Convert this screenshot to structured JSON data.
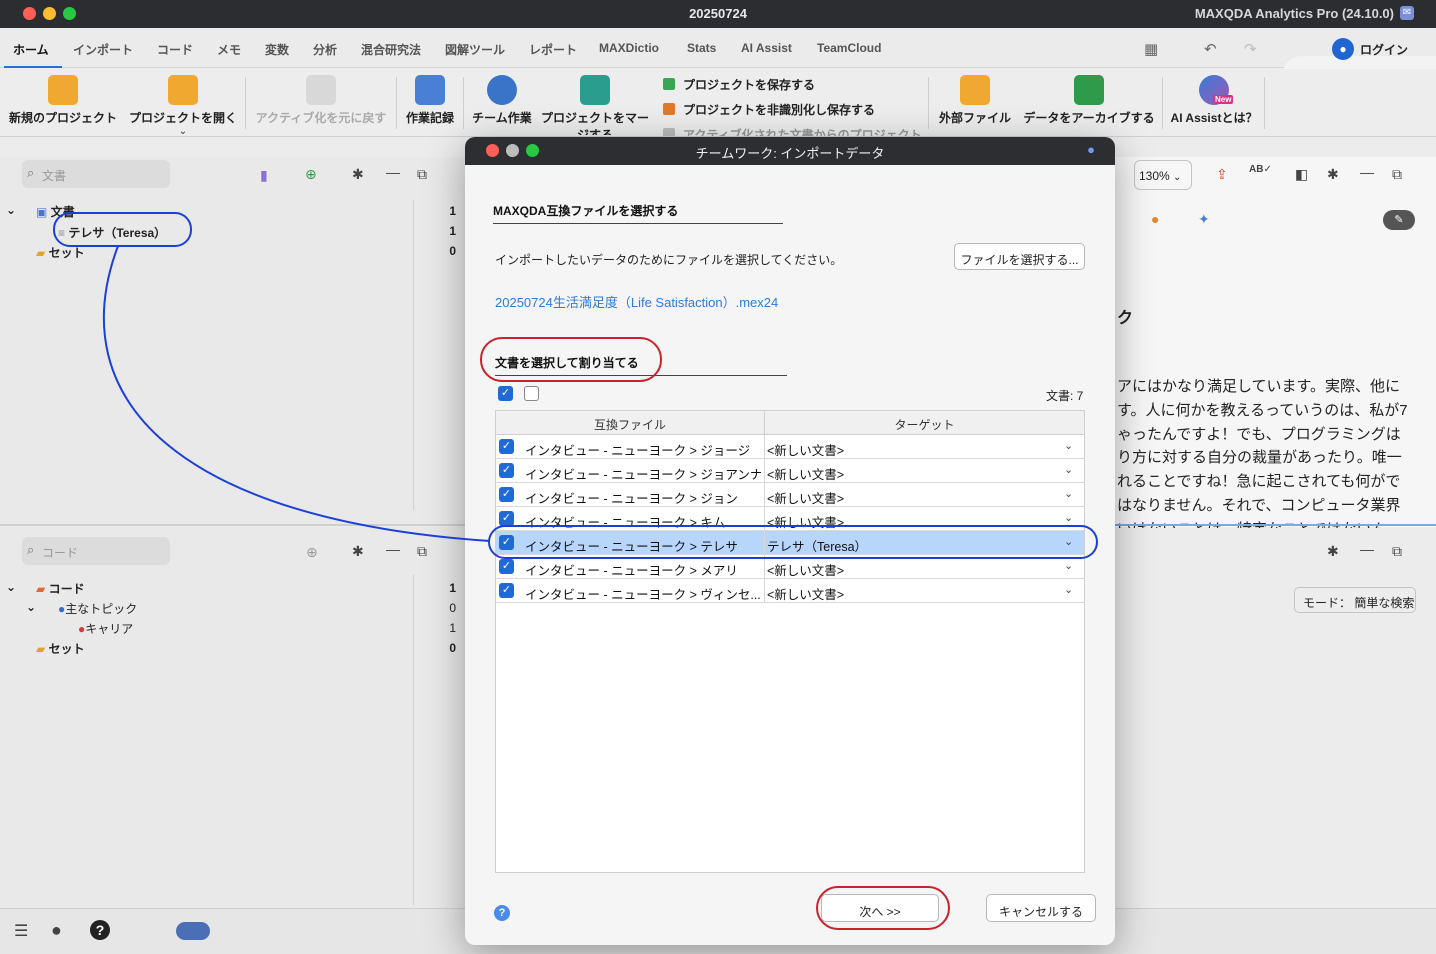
{
  "window": {
    "title": "20250724",
    "app": "MAXQDA Analytics Pro (24.10.0)"
  },
  "colors": {
    "accent": "#1f6ad4",
    "link": "#2f7bd8",
    "selection": "#b8d6fb",
    "annotation_red": "#c8222a",
    "annotation_blue": "#1c3fd8"
  },
  "menu": {
    "tabs": [
      "ホーム",
      "インポート",
      "コード",
      "メモ",
      "変数",
      "分析",
      "混合研究法",
      "図解ツール",
      "レポート",
      "MAXDictio",
      "Stats",
      "AI Assist",
      "TeamCloud"
    ],
    "login": "ログイン"
  },
  "ribbon": {
    "new_project": "新規のプロジェクト",
    "open_project": "プロジェクトを開く",
    "undo_activation": "アクティブ化を元に戻す",
    "log": "作業記録",
    "teamwork": "チーム作業",
    "merge_project": "プロジェクトをマー",
    "merge_project_2": "ジする",
    "save_project": "プロジェクトを保存する",
    "save_anon": "プロジェクトを非識別化し保存する",
    "from_active": "アクティブ化された文書からのプロジェクト",
    "external_files": "外部ファイル",
    "archive": "データをアーカイブする",
    "ai_assist": "AI Assistとは？",
    "ai_new": "New"
  },
  "documents_pane": {
    "search_placeholder": "文書",
    "items": [
      {
        "label": "文書",
        "count": "1"
      },
      {
        "label": "テレサ（Teresa）",
        "count": "1"
      },
      {
        "label": "セット",
        "count": "0"
      }
    ]
  },
  "codes_pane": {
    "search_placeholder": "コード",
    "items": [
      {
        "label": "コード",
        "count": "1"
      },
      {
        "label": "主なトピック",
        "count": "0"
      },
      {
        "label": "キャリア",
        "count": "1"
      },
      {
        "label": "セット",
        "count": "0"
      }
    ]
  },
  "right_pane": {
    "zoom": "130%",
    "heading_fragment": "ク",
    "text_lines": [
      "アにはかなり満足しています。実際、他に",
      "す。人に何かを教えるっていうのは、私が7",
      "ゃったんですよ！でも、プログラミングは",
      "り方に対する自分の裁量があったり。唯一",
      "れることですね！急に起こされても何がで",
      "はなりません。それで、コンピュータ業界",
      "いけないことは、特定なことではないん"
    ],
    "mode": "モード： 簡単な検索"
  },
  "dialog": {
    "title": "チームワーク: インポートデータ",
    "section1": "MAXQDA互換ファイルを選択する",
    "instruction": "インポートしたいデータのためにファイルを選択してください。",
    "choose_file": "ファイルを選択する...",
    "file_name": "20250724生活満足度（Life Satisfaction）.mex24",
    "section2": "文書を選択して割り当てる",
    "doc_count": "文書: 7",
    "col_source": "互換ファイル",
    "col_target": "ターゲット",
    "rows": [
      {
        "source": "インタビュー - ニューヨーク > ジョージ",
        "target": "<新しい文書>",
        "checked": true
      },
      {
        "source": "インタビュー - ニューヨーク > ジョアンナ",
        "target": "<新しい文書>",
        "checked": true
      },
      {
        "source": "インタビュー - ニューヨーク > ジョン",
        "target": "<新しい文書>",
        "checked": true
      },
      {
        "source": "インタビュー - ニューヨーク > キム",
        "target": "<新しい文書>",
        "checked": true
      },
      {
        "source": "インタビュー - ニューヨーク > テレサ",
        "target": "テレサ（Teresa）",
        "checked": true
      },
      {
        "source": "インタビュー - ニューヨーク > メアリ",
        "target": "<新しい文書>",
        "checked": true
      },
      {
        "source": "インタビュー - ニューヨーク > ヴィンセ...",
        "target": "<新しい文書>",
        "checked": true
      }
    ],
    "next": "次へ >>",
    "cancel": "キャンセルする"
  }
}
